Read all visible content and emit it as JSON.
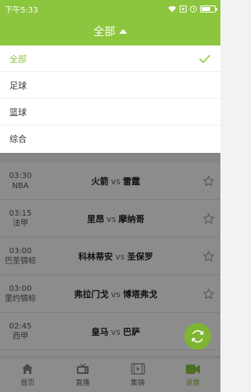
{
  "status_bar": {
    "time": "下午5:33",
    "battery_level": 0.7
  },
  "header": {
    "title": "全部"
  },
  "filter_menu": {
    "items": [
      {
        "label": "全部",
        "selected": true
      },
      {
        "label": "足球",
        "selected": false
      },
      {
        "label": "篮球",
        "selected": false
      },
      {
        "label": "综合",
        "selected": false
      }
    ]
  },
  "matches": [
    {
      "time": "03:30",
      "league": "NBA",
      "home": "火箭",
      "vs": "vs",
      "away": "雷霆"
    },
    {
      "time": "03:15",
      "league": "法甲",
      "home": "里昂",
      "vs": "vs",
      "away": "摩纳哥"
    },
    {
      "time": "03:00",
      "league": "巴圣锦标",
      "home": "科林蒂安",
      "vs": "vs",
      "away": "圣保罗"
    },
    {
      "time": "03:00",
      "league": "里约锦标",
      "home": "弗拉门戈",
      "vs": "vs",
      "away": "博塔弗戈"
    },
    {
      "time": "02:45",
      "league": "西甲",
      "home": "皇马",
      "vs": "vs",
      "away": "巴萨"
    }
  ],
  "tabbar": {
    "items": [
      {
        "label": "首页",
        "icon": "home-icon"
      },
      {
        "label": "直播",
        "icon": "tv-icon"
      },
      {
        "label": "集锦",
        "icon": "film-icon"
      },
      {
        "label": "录像",
        "icon": "video-camera-icon"
      }
    ]
  },
  "colors": {
    "accent": "#8cc63e",
    "fab": "#7fb532"
  }
}
